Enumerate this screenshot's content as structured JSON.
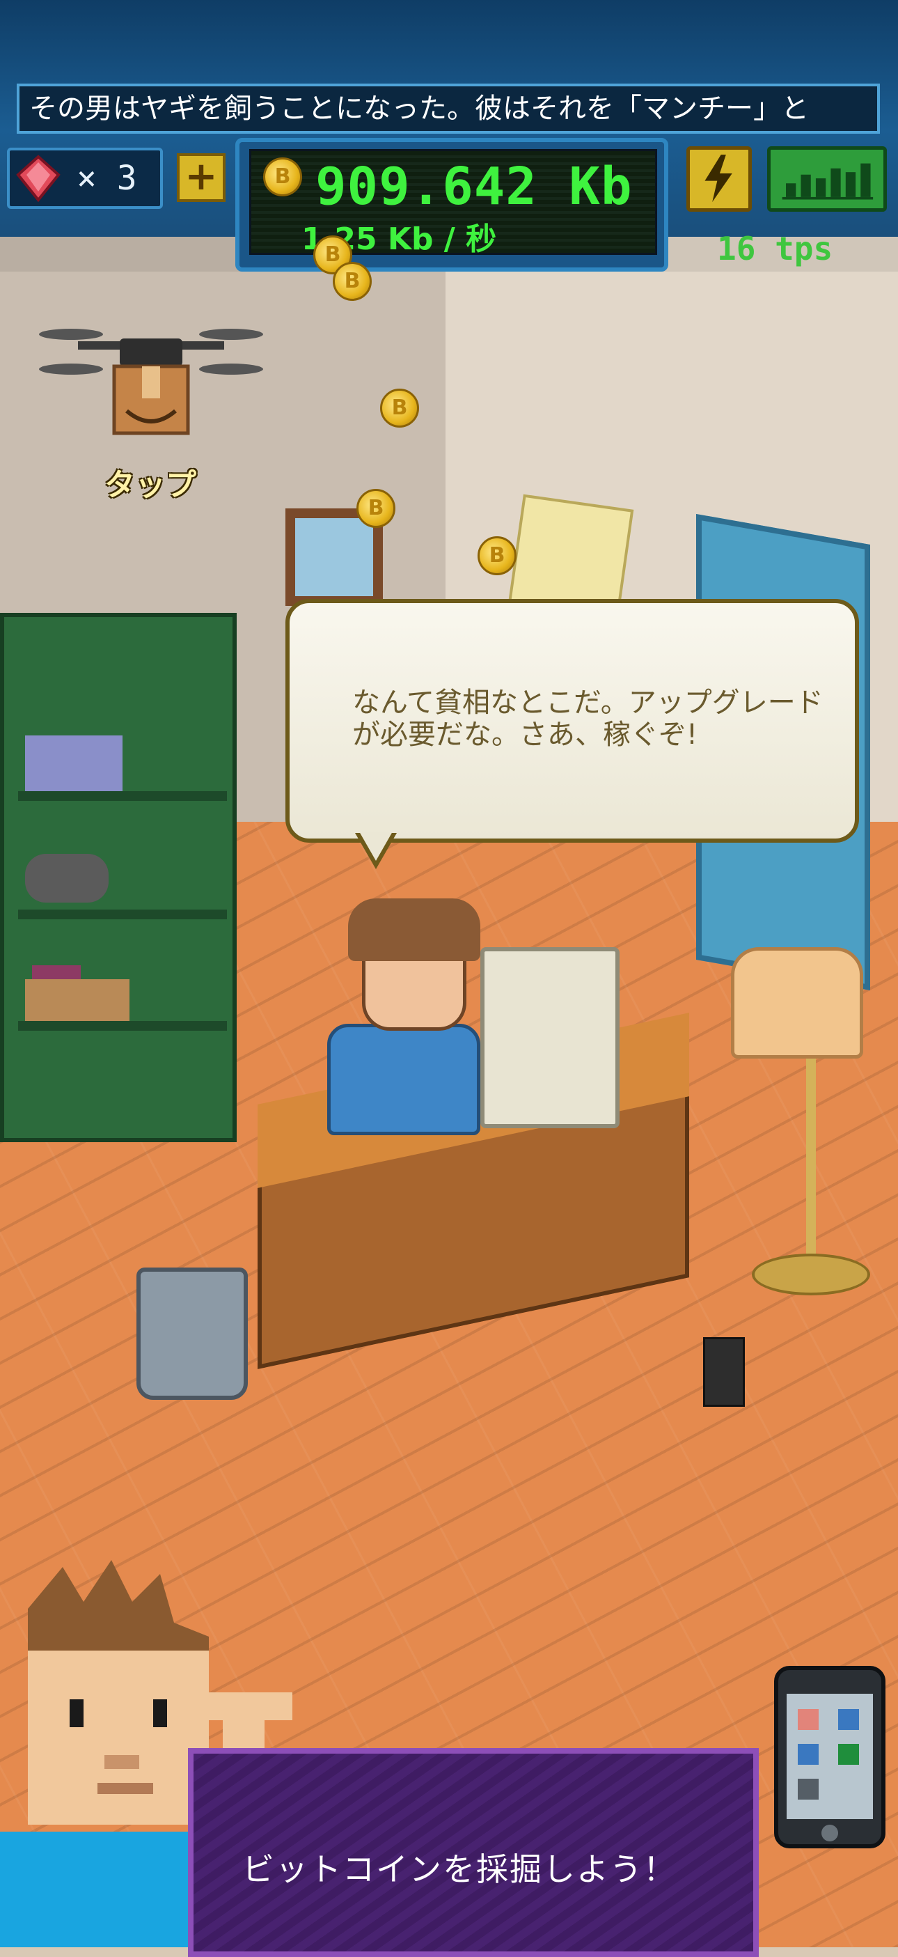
{
  "ticker": {
    "text": "その男はヤギを飼うことになった。彼はそれを「マンチー」と"
  },
  "currency": {
    "gems": "× 3",
    "add_label": "+",
    "balance": "909.642 Kb",
    "rate": "1.25 Kb / 秒",
    "tps": "16 tps"
  },
  "drone": {
    "tap_label": "タップ"
  },
  "speech": {
    "text": "なんて貧相なとこだ。アップグレードが必要だな。さあ、稼ぐぞ!"
  },
  "dialog": {
    "text": "ビットコインを採掘しよう！"
  },
  "icons": {
    "gem": "gem-icon",
    "bolt": "lightning-icon",
    "stats": "bar-chart-icon",
    "coin": "bitcoin-icon",
    "phone": "smartphone-icon"
  },
  "colors": {
    "header": "#1b5d92",
    "balance_text": "#3ff23f",
    "floor": "#e58a4e",
    "dialog_bg": "#3f1c63"
  }
}
